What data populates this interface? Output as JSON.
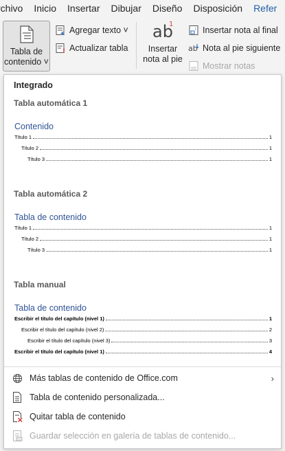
{
  "ribbon_tabs": [
    "rchivo",
    "Inicio",
    "Insertar",
    "Dibujar",
    "Diseño",
    "Disposición",
    "Refer"
  ],
  "ribbon": {
    "toc_button_line1": "Tabla de",
    "toc_button_line2": "contenido ˅",
    "add_text": "Agregar texto ˅",
    "update_table": "Actualizar tabla",
    "insert_footnote_line1": "Insertar",
    "insert_footnote_line2": "nota al pie",
    "insert_endnote": "Insertar nota al final",
    "next_footnote": "Nota al pie siguiente",
    "show_notes": "Mostrar notas"
  },
  "panel": {
    "section_builtin": "Integrado",
    "auto1": {
      "title": "Tabla automática 1",
      "heading": "Contenido",
      "lines": [
        {
          "text": "Título 1",
          "page": "1"
        },
        {
          "text": "Título 2",
          "page": "1"
        },
        {
          "text": "Título 3",
          "page": "1"
        }
      ]
    },
    "auto2": {
      "title": "Tabla automática 2",
      "heading": "Tabla de contenido",
      "lines": [
        {
          "text": "Título 1",
          "page": "1"
        },
        {
          "text": "Título 2",
          "page": "1"
        },
        {
          "text": "Título 3",
          "page": "1"
        }
      ]
    },
    "manual": {
      "title": "Tabla manual",
      "heading": "Tabla de contenido",
      "lines": [
        {
          "text": "Escribir el título del capítulo (nivel 1)",
          "page": "1"
        },
        {
          "text": "Escribir el título del capítulo (nivel 2)",
          "page": "2"
        },
        {
          "text": "Escribir el título del capítulo (nivel 3)",
          "page": "3"
        },
        {
          "text": "Escribir el título del capítulo (nivel 1)",
          "page": "4"
        }
      ]
    },
    "menu": {
      "more_office": "Más tablas de contenido de Office.com",
      "custom_toc": "Tabla de contenido personalizada...",
      "remove_toc": "Quitar tabla de contenido",
      "save_selection": "Guardar selección en galería de tablas de contenido..."
    }
  }
}
